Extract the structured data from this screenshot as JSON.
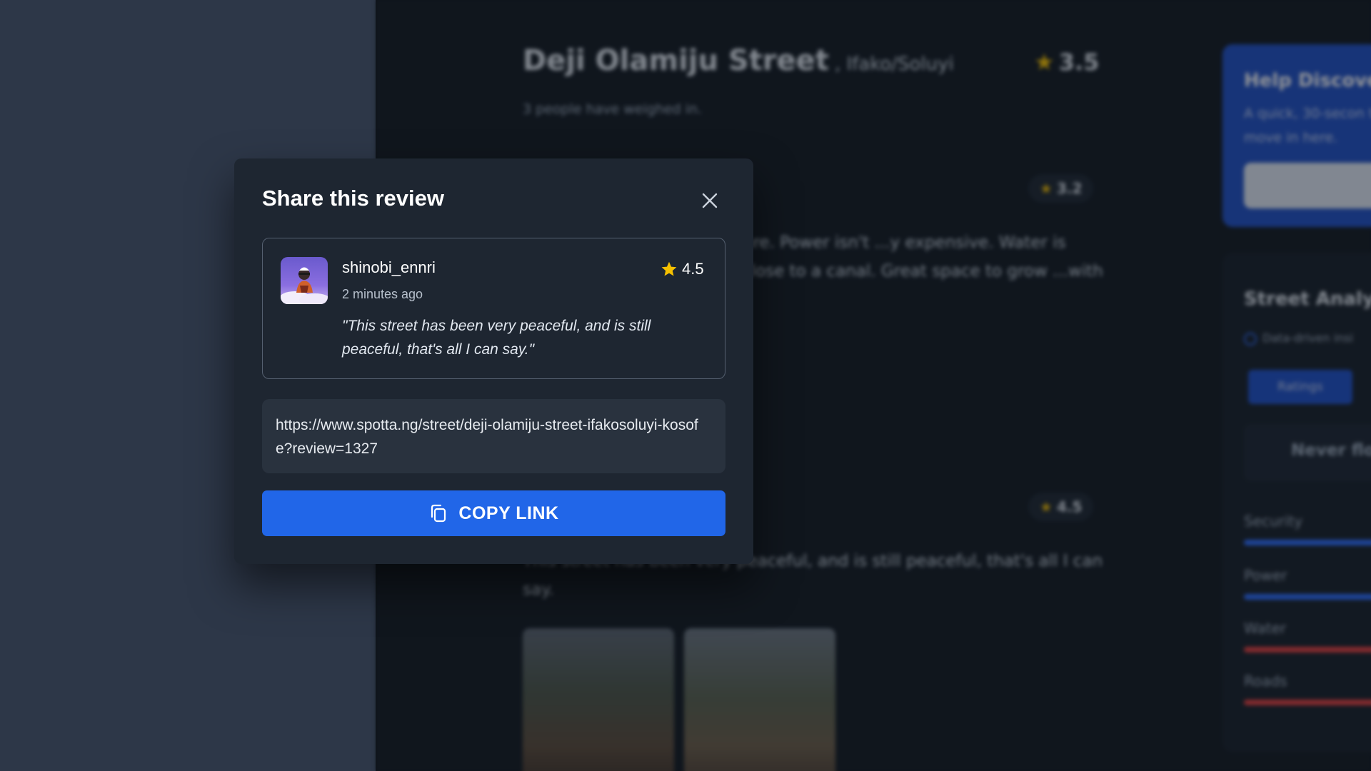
{
  "background_page": {
    "street_name": "Deji Olamiju Street",
    "street_location": ", Ifako/Soluyi",
    "overall_rating": "3.5",
    "weigh_in_text": "3 people have weighed in.",
    "reviews": [
      {
        "rating": "3.2",
        "text": "...live. Quiet spot, very secure. Power isn't ...y expensive. Water is terrible. There's iron ...are close to a canal. Great space to grow ...with established adults."
      },
      {
        "rating": "4.5",
        "text": "This street has been very peaceful, and is still peaceful, that's all I can say."
      }
    ],
    "help_card": {
      "title": "Help Discover",
      "subtitle": "A quick, 30-secon to move in here."
    },
    "analysis": {
      "title": "Street Analys",
      "radio_label": "Data-driven insi",
      "tab_label": "Ratings",
      "note": "Never flo",
      "metrics": [
        {
          "label": "Security",
          "color": "#2b6cff"
        },
        {
          "label": "Power",
          "color": "#2b6cff"
        },
        {
          "label": "Water",
          "color": "#e53e3e"
        },
        {
          "label": "Roads",
          "color": "#e53e3e"
        }
      ]
    }
  },
  "modal": {
    "title": "Share this review",
    "close_icon": "close-icon",
    "review": {
      "username": "shinobi_ennri",
      "timestamp": "2 minutes ago",
      "rating": "4.5",
      "quote": "\"This street has been very peaceful, and is still peaceful, that's all I can say.\""
    },
    "share_url": "https://www.spotta.ng/street/deji-olamiju-street-ifakosoluyi-kosofe?review=1327",
    "copy_button_label": "COPY LINK",
    "copy_icon": "copy-icon"
  },
  "colors": {
    "accent": "#2166e8",
    "star": "#f6c000",
    "modal_bg": "#1e2631",
    "left_pane": "#2d3748"
  }
}
